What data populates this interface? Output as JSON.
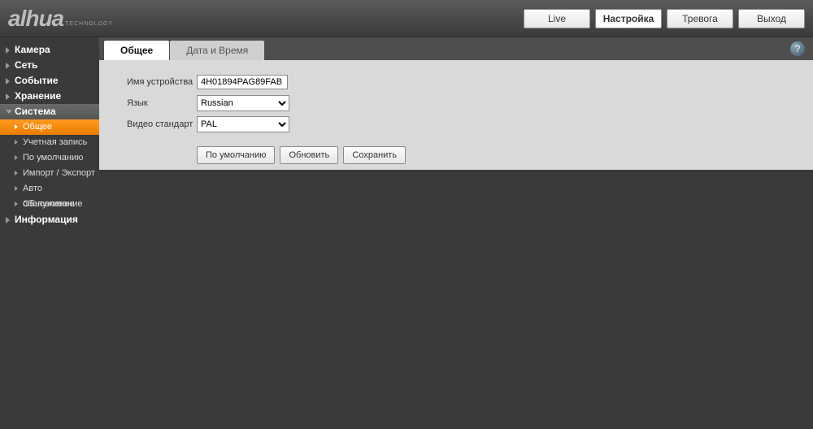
{
  "logo": {
    "main": "alhua",
    "sub": "TECHNOLOGY"
  },
  "topnav": {
    "live": "Live",
    "settings": "Настройка",
    "alarm": "Тревога",
    "logout": "Выход"
  },
  "sidebar": {
    "camera": "Камера",
    "network": "Сеть",
    "event": "Событие",
    "storage": "Хранение",
    "system": "Система",
    "system_children": {
      "general": "Общее",
      "account": "Учетная запись",
      "default": "По умолчанию",
      "import_export": "Импорт / Экспорт",
      "auto_maintain": "Авто обслуживание",
      "upgrade": "Обновление"
    },
    "info": "Информация"
  },
  "tabs": {
    "general": "Общее",
    "datetime": "Дата и Время"
  },
  "form": {
    "device_name_label": "Имя устройства",
    "device_name_value": "4H01894PAG89FAB",
    "language_label": "Язык",
    "language_value": "Russian",
    "video_standard_label": "Видео стандарт",
    "video_standard_value": "PAL"
  },
  "buttons": {
    "default": "По умолчанию",
    "refresh": "Обновить",
    "save": "Сохранить"
  },
  "help": "?"
}
